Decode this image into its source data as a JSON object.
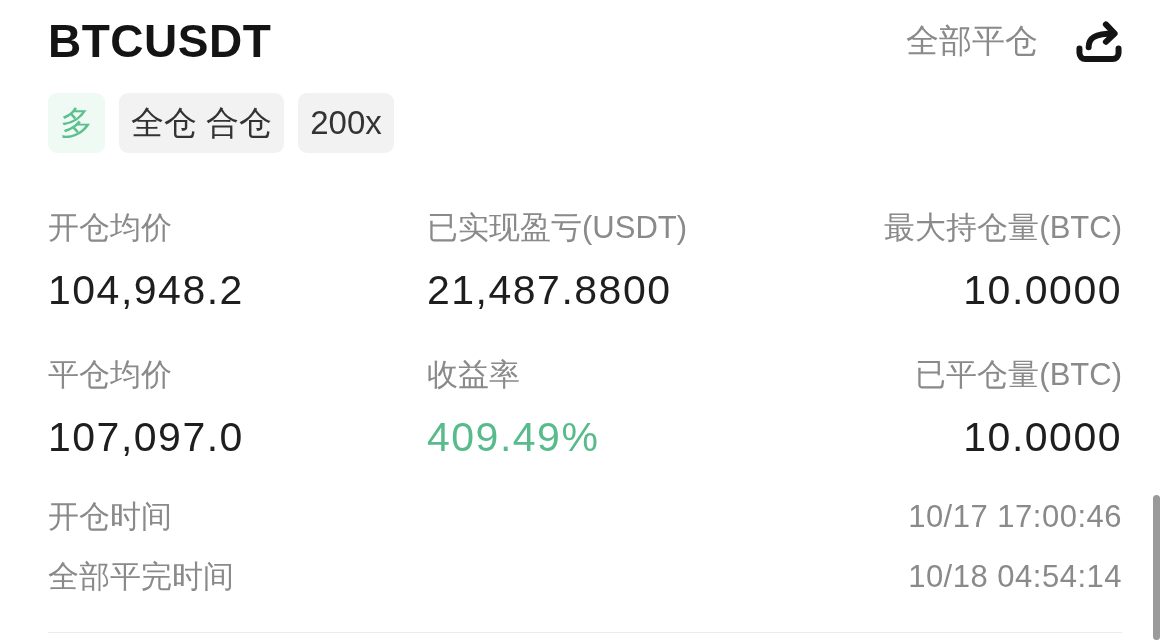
{
  "header": {
    "symbol": "BTCUSDT",
    "close_all": "全部平仓"
  },
  "tags": [
    {
      "label": "多",
      "kind": "side"
    },
    {
      "label": "全仓 合仓",
      "kind": "mode"
    },
    {
      "label": "200x",
      "kind": "leverage"
    }
  ],
  "stats": [
    {
      "label": "开仓均价",
      "value": "104,948.2",
      "kind": "plain"
    },
    {
      "label": "已实现盈亏(USDT)",
      "value": "21,487.8800",
      "kind": "plain"
    },
    {
      "label": "最大持仓量(BTC)",
      "value": "10.0000",
      "kind": "plain"
    },
    {
      "label": "平仓均价",
      "value": "107,097.0",
      "kind": "plain"
    },
    {
      "label": "收益率",
      "value": "409.49%",
      "kind": "positive"
    },
    {
      "label": "已平仓量(BTC)",
      "value": "10.0000",
      "kind": "plain"
    }
  ],
  "times": [
    {
      "label": "开仓时间",
      "value": "10/17 17:00:46"
    },
    {
      "label": "全部平完时间",
      "value": "10/18 04:54:14"
    }
  ]
}
